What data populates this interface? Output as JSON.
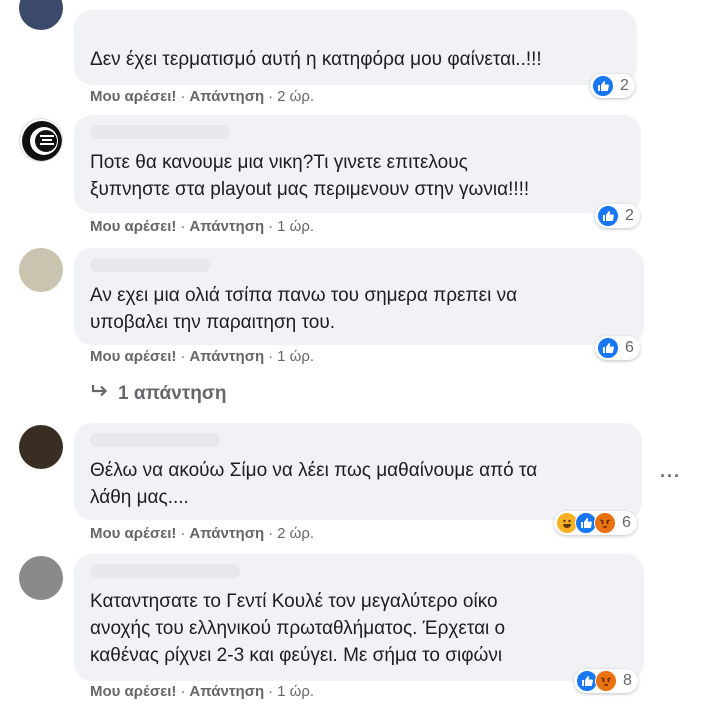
{
  "comments": [
    {
      "text": "Δεν έχει τερματισμό αυτή η κατηφόρα μου φαίνεται..!!!",
      "like": "Μου αρέσει!",
      "reply": "Απάντηση",
      "time": "2 ώρ.",
      "reaction_count": "2",
      "reactions": [
        "like-icon"
      ]
    },
    {
      "text": "Ποτε θα κανουμε μια νικη?Τι γινετε επιτελους\nξυπνηστε στα playout μας περιμενουν στην γωνια!!!!",
      "like": "Μου αρέσει!",
      "reply": "Απάντηση",
      "time": "1 ώρ.",
      "reaction_count": "2",
      "reactions": [
        "like-icon"
      ]
    },
    {
      "text": "Αν εχει μια ολιά τσίπα πανω του σημερα πρεπει να\nυποβαλει την παραιτηση του.",
      "like": "Μου αρέσει!",
      "reply": "Απάντηση",
      "time": "1 ώρ.",
      "reaction_count": "6",
      "reactions": [
        "like-icon"
      ]
    },
    {
      "text": "Θέλω να ακούω Σίμο να λέει πως μαθαίνουμε από τα\nλάθη μας....",
      "like": "Μου αρέσει!",
      "reply": "Απάντηση",
      "time": "2 ώρ.",
      "reaction_count": "6",
      "reactions": [
        "haha-icon",
        "like-icon",
        "angry-icon"
      ]
    },
    {
      "text": "Καταντησατε το Γεντί Κουλέ τον μεγαλύτερο οίκο\nανοχής του ελληνικού πρωταθλήματος. Έρχεται ο\nκαθένας ρίχνει 2-3 και φεύγει. Με σήμα το σιφώνι",
      "like": "Μου αρέσει!",
      "reply": "Απάντηση",
      "time": "1 ώρ.",
      "reaction_count": "8",
      "reactions": [
        "like-icon",
        "angry-icon"
      ]
    }
  ],
  "replies_link": "1 απάντηση",
  "sep": "·",
  "colors": {
    "like": "#1877f2",
    "haha": "#f7b125",
    "angry": "#e9710f",
    "bubble": "#f0f2f5",
    "meta": "#65676b"
  }
}
